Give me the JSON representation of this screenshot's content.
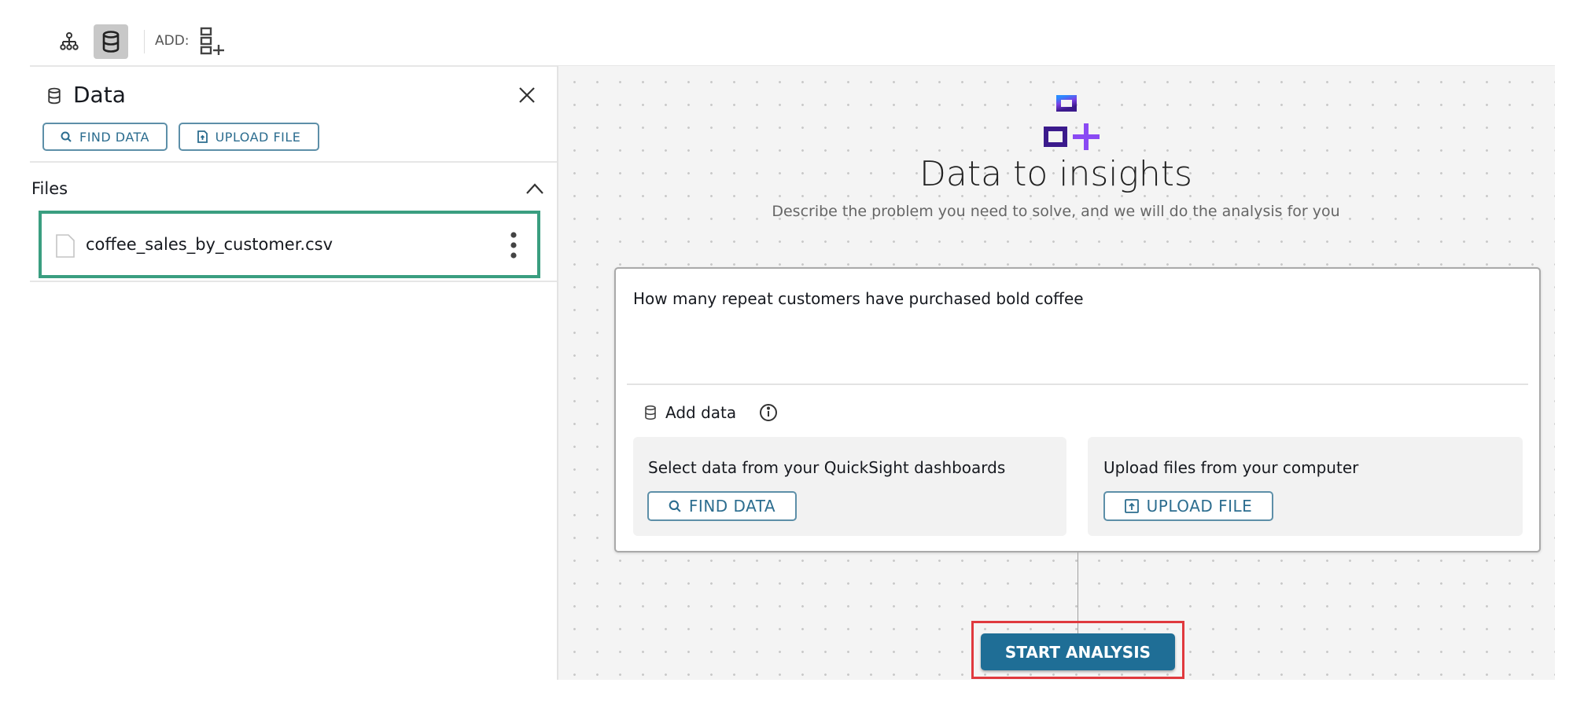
{
  "toolbar": {
    "add_label": "ADD:",
    "icons": [
      "hierarchy-icon",
      "database-icon",
      "add-flow-icon"
    ]
  },
  "data_panel": {
    "title": "Data",
    "find_data_label": "FIND DATA",
    "upload_file_label": "UPLOAD FILE",
    "files_section_label": "Files",
    "files": [
      {
        "name": "coffee_sales_by_customer.csv"
      }
    ]
  },
  "main": {
    "title": "Data to insights",
    "subtitle": "Describe the problem you need to solve, and we will do the analysis for you",
    "question_value": "How many repeat customers have purchased bold coffee",
    "add_data_label": "Add data",
    "dashboards_option": {
      "text": "Select data from your QuickSight dashboards",
      "button_label": "FIND DATA"
    },
    "upload_option": {
      "text": "Upload files from your computer",
      "button_label": "UPLOAD FILE"
    },
    "start_button_label": "START ANALYSIS"
  },
  "colors": {
    "primary_button": "#1f6e96",
    "selected_file_border": "#3a9e80",
    "highlight_box": "#e0393e",
    "outline_button_text": "#2c6d8f"
  }
}
